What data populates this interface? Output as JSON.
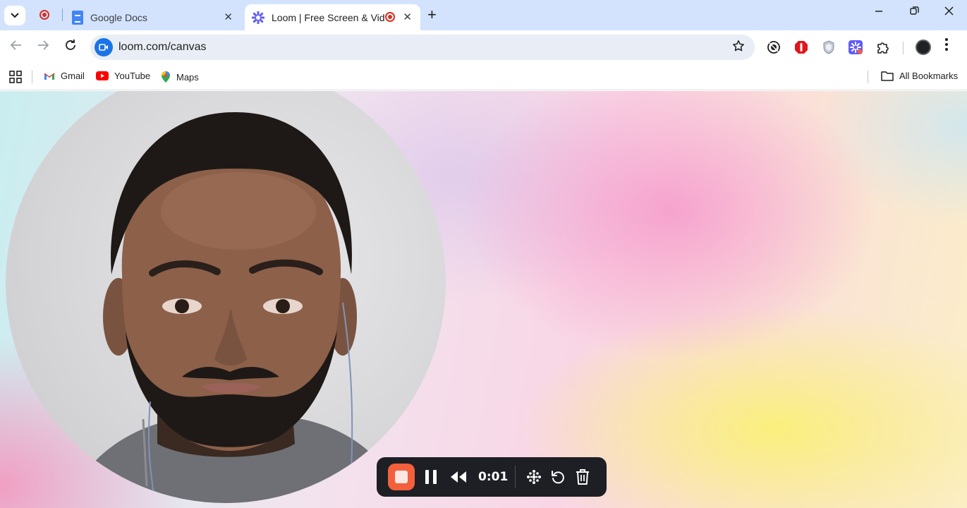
{
  "browser": {
    "tabs": [
      {
        "title": "Google Docs",
        "active": false
      },
      {
        "title": "Loom | Free Screen & Video Recording",
        "active": true
      }
    ],
    "address": {
      "url": "loom.com/canvas"
    },
    "bookmarks": [
      {
        "label": "Gmail"
      },
      {
        "label": "YouTube"
      },
      {
        "label": "Maps"
      }
    ],
    "all_bookmarks_label": "All Bookmarks"
  },
  "recorder": {
    "timer": "0:01"
  },
  "colors": {
    "tabstrip": "#d3e3fd",
    "stop_button": "#f2603c",
    "control_bar": "#1d1f24",
    "record_red": "#d93025"
  }
}
